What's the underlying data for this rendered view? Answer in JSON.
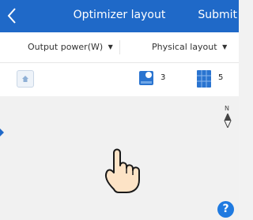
{
  "header": {
    "title": "Optimizer layout",
    "submit_label": "Submit",
    "back_icon": "chevron-left-icon"
  },
  "filters": {
    "output_power": "Output power(W)",
    "layout": "Physical layout"
  },
  "devices": {
    "home_icon": "home-icon",
    "inverter_count": "3",
    "panel_count": "5",
    "inverter_icon": "inverter-icon",
    "panel_icon": "solar-panel-icon"
  },
  "canvas": {
    "compass_label": "N",
    "help_label": "?"
  },
  "colors": {
    "accent": "#1f69c8",
    "help": "#1f7ae0",
    "background": "#f2f2f2"
  }
}
